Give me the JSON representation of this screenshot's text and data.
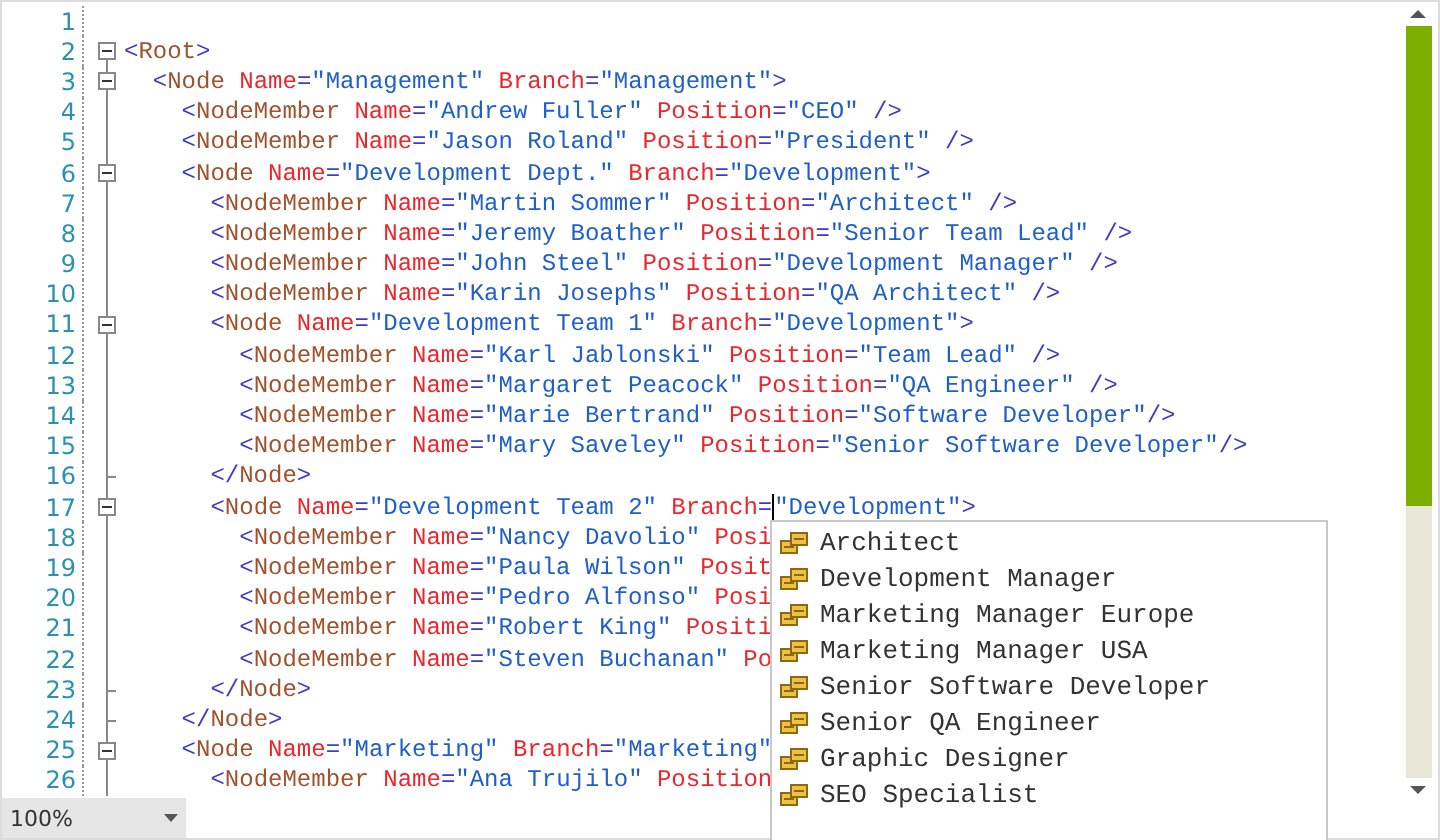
{
  "editor": {
    "lines": [
      {
        "number": "1",
        "kind": "outside"
      },
      {
        "number": "2",
        "kind": "start",
        "tokens": [
          {
            "kind": "punct",
            "text": "<"
          },
          {
            "kind": "tag",
            "text": "Root"
          },
          {
            "kind": "punct",
            "text": ">"
          }
        ]
      },
      {
        "number": "3",
        "kind": "start",
        "tokens": [
          {
            "kind": "punct",
            "text": "  <"
          },
          {
            "kind": "tag",
            "text": "Node"
          },
          {
            "kind": "attr",
            "text": " Name"
          },
          {
            "kind": "punct",
            "text": "="
          },
          {
            "kind": "value",
            "text": "\"Management\""
          },
          {
            "kind": "attr",
            "text": " Branch"
          },
          {
            "kind": "punct",
            "text": "="
          },
          {
            "kind": "value",
            "text": "\"Management\""
          },
          {
            "kind": "punct",
            "text": ">"
          }
        ]
      },
      {
        "number": "4",
        "kind": "inner",
        "tokens": [
          {
            "kind": "punct",
            "text": "    <"
          },
          {
            "kind": "tag",
            "text": "NodeMember"
          },
          {
            "kind": "attr",
            "text": " Name"
          },
          {
            "kind": "punct",
            "text": "="
          },
          {
            "kind": "value",
            "text": "\"Andrew Fuller\""
          },
          {
            "kind": "attr",
            "text": " Position"
          },
          {
            "kind": "punct",
            "text": "="
          },
          {
            "kind": "value",
            "text": "\"CEO\""
          },
          {
            "kind": "punct",
            "text": " />"
          }
        ]
      },
      {
        "number": "5",
        "kind": "inner",
        "tokens": [
          {
            "kind": "punct",
            "text": "    <"
          },
          {
            "kind": "tag",
            "text": "NodeMember"
          },
          {
            "kind": "attr",
            "text": " Name"
          },
          {
            "kind": "punct",
            "text": "="
          },
          {
            "kind": "value",
            "text": "\"Jason Roland\""
          },
          {
            "kind": "attr",
            "text": " Position"
          },
          {
            "kind": "punct",
            "text": "="
          },
          {
            "kind": "value",
            "text": "\"President\""
          },
          {
            "kind": "punct",
            "text": " />"
          }
        ]
      },
      {
        "number": "6",
        "kind": "start",
        "tokens": [
          {
            "kind": "punct",
            "text": "    <"
          },
          {
            "kind": "tag",
            "text": "Node"
          },
          {
            "kind": "attr",
            "text": " Name"
          },
          {
            "kind": "punct",
            "text": "="
          },
          {
            "kind": "value",
            "text": "\"Development Dept.\""
          },
          {
            "kind": "attr",
            "text": " Branch"
          },
          {
            "kind": "punct",
            "text": "="
          },
          {
            "kind": "value",
            "text": "\"Development\""
          },
          {
            "kind": "punct",
            "text": ">"
          }
        ]
      },
      {
        "number": "7",
        "kind": "inner",
        "tokens": [
          {
            "kind": "punct",
            "text": "      <"
          },
          {
            "kind": "tag",
            "text": "NodeMember"
          },
          {
            "kind": "attr",
            "text": " Name"
          },
          {
            "kind": "punct",
            "text": "="
          },
          {
            "kind": "value",
            "text": "\"Martin Sommer\""
          },
          {
            "kind": "attr",
            "text": " Position"
          },
          {
            "kind": "punct",
            "text": "="
          },
          {
            "kind": "value",
            "text": "\"Architect\""
          },
          {
            "kind": "punct",
            "text": " />"
          }
        ]
      },
      {
        "number": "8",
        "kind": "inner",
        "tokens": [
          {
            "kind": "punct",
            "text": "      <"
          },
          {
            "kind": "tag",
            "text": "NodeMember"
          },
          {
            "kind": "attr",
            "text": " Name"
          },
          {
            "kind": "punct",
            "text": "="
          },
          {
            "kind": "value",
            "text": "\"Jeremy Boather\""
          },
          {
            "kind": "attr",
            "text": " Position"
          },
          {
            "kind": "punct",
            "text": "="
          },
          {
            "kind": "value",
            "text": "\"Senior Team Lead\""
          },
          {
            "kind": "punct",
            "text": " />"
          }
        ]
      },
      {
        "number": "9",
        "kind": "inner",
        "tokens": [
          {
            "kind": "punct",
            "text": "      <"
          },
          {
            "kind": "tag",
            "text": "NodeMember"
          },
          {
            "kind": "attr",
            "text": " Name"
          },
          {
            "kind": "punct",
            "text": "="
          },
          {
            "kind": "value",
            "text": "\"John Steel\""
          },
          {
            "kind": "attr",
            "text": " Position"
          },
          {
            "kind": "punct",
            "text": "="
          },
          {
            "kind": "value",
            "text": "\"Development Manager\""
          },
          {
            "kind": "punct",
            "text": " />"
          }
        ]
      },
      {
        "number": "10",
        "kind": "inner",
        "tokens": [
          {
            "kind": "punct",
            "text": "      <"
          },
          {
            "kind": "tag",
            "text": "NodeMember"
          },
          {
            "kind": "attr",
            "text": " Name"
          },
          {
            "kind": "punct",
            "text": "="
          },
          {
            "kind": "value",
            "text": "\"Karin Josephs\""
          },
          {
            "kind": "attr",
            "text": " Position"
          },
          {
            "kind": "punct",
            "text": "="
          },
          {
            "kind": "value",
            "text": "\"QA Architect\""
          },
          {
            "kind": "punct",
            "text": " />"
          }
        ]
      },
      {
        "number": "11",
        "kind": "start",
        "tokens": [
          {
            "kind": "punct",
            "text": "      <"
          },
          {
            "kind": "tag",
            "text": "Node"
          },
          {
            "kind": "attr",
            "text": " Name"
          },
          {
            "kind": "punct",
            "text": "="
          },
          {
            "kind": "value",
            "text": "\"Development Team 1\""
          },
          {
            "kind": "attr",
            "text": " Branch"
          },
          {
            "kind": "punct",
            "text": "="
          },
          {
            "kind": "value",
            "text": "\"Development\""
          },
          {
            "kind": "punct",
            "text": ">"
          }
        ]
      },
      {
        "number": "12",
        "kind": "inner",
        "tokens": [
          {
            "kind": "punct",
            "text": "        <"
          },
          {
            "kind": "tag",
            "text": "NodeMember"
          },
          {
            "kind": "attr",
            "text": " Name"
          },
          {
            "kind": "punct",
            "text": "="
          },
          {
            "kind": "value",
            "text": "\"Karl Jablonski\""
          },
          {
            "kind": "attr",
            "text": " Position"
          },
          {
            "kind": "punct",
            "text": "="
          },
          {
            "kind": "value",
            "text": "\"Team Lead\""
          },
          {
            "kind": "punct",
            "text": " />"
          }
        ]
      },
      {
        "number": "13",
        "kind": "inner",
        "tokens": [
          {
            "kind": "punct",
            "text": "        <"
          },
          {
            "kind": "tag",
            "text": "NodeMember"
          },
          {
            "kind": "attr",
            "text": " Name"
          },
          {
            "kind": "punct",
            "text": "="
          },
          {
            "kind": "value",
            "text": "\"Margaret Peacock\""
          },
          {
            "kind": "attr",
            "text": " Position"
          },
          {
            "kind": "punct",
            "text": "="
          },
          {
            "kind": "value",
            "text": "\"QA Engineer\""
          },
          {
            "kind": "punct",
            "text": " />"
          }
        ]
      },
      {
        "number": "14",
        "kind": "inner",
        "tokens": [
          {
            "kind": "punct",
            "text": "        <"
          },
          {
            "kind": "tag",
            "text": "NodeMember"
          },
          {
            "kind": "attr",
            "text": " Name"
          },
          {
            "kind": "punct",
            "text": "="
          },
          {
            "kind": "value",
            "text": "\"Marie Bertrand\""
          },
          {
            "kind": "attr",
            "text": " Position"
          },
          {
            "kind": "punct",
            "text": "="
          },
          {
            "kind": "value",
            "text": "\"Software Developer\""
          },
          {
            "kind": "punct",
            "text": "/>"
          }
        ]
      },
      {
        "number": "15",
        "kind": "inner",
        "tokens": [
          {
            "kind": "punct",
            "text": "        <"
          },
          {
            "kind": "tag",
            "text": "NodeMember"
          },
          {
            "kind": "attr",
            "text": " Name"
          },
          {
            "kind": "punct",
            "text": "="
          },
          {
            "kind": "value",
            "text": "\"Mary Saveley\""
          },
          {
            "kind": "attr",
            "text": " Position"
          },
          {
            "kind": "punct",
            "text": "="
          },
          {
            "kind": "value",
            "text": "\"Senior Software Developer\""
          },
          {
            "kind": "punct",
            "text": "/>"
          }
        ]
      },
      {
        "number": "16",
        "kind": "end",
        "tokens": [
          {
            "kind": "punct",
            "text": "      </"
          },
          {
            "kind": "tag",
            "text": "Node"
          },
          {
            "kind": "punct",
            "text": ">"
          }
        ]
      },
      {
        "number": "17",
        "kind": "start",
        "tokens": [
          {
            "kind": "punct",
            "text": "      <"
          },
          {
            "kind": "tag",
            "text": "Node"
          },
          {
            "kind": "attr",
            "text": " Name"
          },
          {
            "kind": "punct",
            "text": "="
          },
          {
            "kind": "value",
            "text": "\"Development Team 2\""
          },
          {
            "kind": "attr",
            "text": " Branch"
          },
          {
            "kind": "punct",
            "text": "="
          },
          {
            "kind": "caret"
          },
          {
            "kind": "value",
            "text": "\"Development\""
          },
          {
            "kind": "punct",
            "text": ">"
          }
        ]
      },
      {
        "number": "18",
        "kind": "inner",
        "tokens": [
          {
            "kind": "punct",
            "text": "        <"
          },
          {
            "kind": "tag",
            "text": "NodeMember"
          },
          {
            "kind": "attr",
            "text": " Name"
          },
          {
            "kind": "punct",
            "text": "="
          },
          {
            "kind": "value",
            "text": "\"Nancy Davolio\""
          },
          {
            "kind": "attr",
            "text": " Posi"
          }
        ]
      },
      {
        "number": "19",
        "kind": "inner",
        "tokens": [
          {
            "kind": "punct",
            "text": "        <"
          },
          {
            "kind": "tag",
            "text": "NodeMember"
          },
          {
            "kind": "attr",
            "text": " Name"
          },
          {
            "kind": "punct",
            "text": "="
          },
          {
            "kind": "value",
            "text": "\"Paula Wilson\""
          },
          {
            "kind": "attr",
            "text": " Posit"
          }
        ]
      },
      {
        "number": "20",
        "kind": "inner",
        "tokens": [
          {
            "kind": "punct",
            "text": "        <"
          },
          {
            "kind": "tag",
            "text": "NodeMember"
          },
          {
            "kind": "attr",
            "text": " Name"
          },
          {
            "kind": "punct",
            "text": "="
          },
          {
            "kind": "value",
            "text": "\"Pedro Alfonso\""
          },
          {
            "kind": "attr",
            "text": " Posi"
          }
        ]
      },
      {
        "number": "21",
        "kind": "inner",
        "tokens": [
          {
            "kind": "punct",
            "text": "        <"
          },
          {
            "kind": "tag",
            "text": "NodeMember"
          },
          {
            "kind": "attr",
            "text": " Name"
          },
          {
            "kind": "punct",
            "text": "="
          },
          {
            "kind": "value",
            "text": "\"Robert King\""
          },
          {
            "kind": "attr",
            "text": " Positi"
          }
        ]
      },
      {
        "number": "22",
        "kind": "inner",
        "tokens": [
          {
            "kind": "punct",
            "text": "        <"
          },
          {
            "kind": "tag",
            "text": "NodeMember"
          },
          {
            "kind": "attr",
            "text": " Name"
          },
          {
            "kind": "punct",
            "text": "="
          },
          {
            "kind": "value",
            "text": "\"Steven Buchanan\""
          },
          {
            "kind": "attr",
            "text": " Po"
          }
        ]
      },
      {
        "number": "23",
        "kind": "end",
        "tokens": [
          {
            "kind": "punct",
            "text": "      </"
          },
          {
            "kind": "tag",
            "text": "Node"
          },
          {
            "kind": "punct",
            "text": ">"
          }
        ]
      },
      {
        "number": "24",
        "kind": "end",
        "tokens": [
          {
            "kind": "punct",
            "text": "    </"
          },
          {
            "kind": "tag",
            "text": "Node"
          },
          {
            "kind": "punct",
            "text": ">"
          }
        ]
      },
      {
        "number": "25",
        "kind": "start",
        "tokens": [
          {
            "kind": "punct",
            "text": "    <"
          },
          {
            "kind": "tag",
            "text": "Node"
          },
          {
            "kind": "attr",
            "text": " Name"
          },
          {
            "kind": "punct",
            "text": "="
          },
          {
            "kind": "value",
            "text": "\"Marketing\""
          },
          {
            "kind": "attr",
            "text": " Branch"
          },
          {
            "kind": "punct",
            "text": "="
          },
          {
            "kind": "value",
            "text": "\"Marketing\""
          }
        ]
      },
      {
        "number": "26",
        "kind": "inner",
        "tokens": [
          {
            "kind": "punct",
            "text": "      <"
          },
          {
            "kind": "tag",
            "text": "NodeMember"
          },
          {
            "kind": "attr",
            "text": " Name"
          },
          {
            "kind": "punct",
            "text": "="
          },
          {
            "kind": "value",
            "text": "\"Ana Trujilo\""
          },
          {
            "kind": "attr",
            "text": " Position"
          }
        ]
      }
    ]
  },
  "completion": {
    "items": [
      {
        "label": "Architect"
      },
      {
        "label": "Development Manager"
      },
      {
        "label": "Marketing Manager Europe"
      },
      {
        "label": "Marketing Manager USA"
      },
      {
        "label": "Senior Software Developer"
      },
      {
        "label": "Senior QA Engineer"
      },
      {
        "label": "Graphic Designer"
      },
      {
        "label": "SEO Specialist"
      }
    ]
  },
  "zoom": {
    "value": "100%"
  }
}
